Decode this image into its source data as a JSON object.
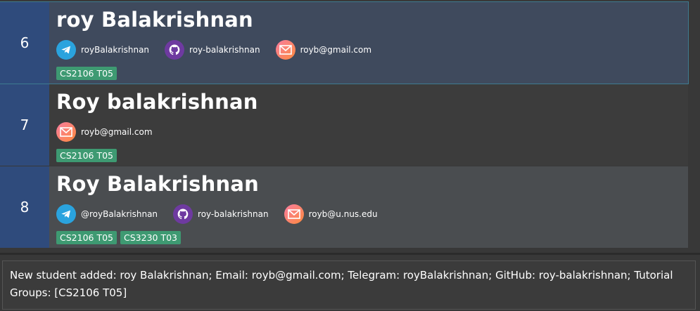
{
  "persons": [
    {
      "index": "6",
      "name": "roy Balakrishnan",
      "telegram": "royBalakrishnan",
      "github": "roy-balakrishnan",
      "email": "royb@gmail.com",
      "tags": [
        "CS2106 T05"
      ]
    },
    {
      "index": "7",
      "name": "Roy balakrishnan",
      "email": "royb@gmail.com",
      "tags": [
        "CS2106 T05"
      ]
    },
    {
      "index": "8",
      "name": "Roy Balakrishnan",
      "telegram": "@royBalakrishnan",
      "github": "roy-balakrishnan",
      "email": "royb@u.nus.edu",
      "tags": [
        "CS2106 T05",
        "CS3230 T03"
      ]
    }
  ],
  "result": {
    "message": "New student added: roy Balakrishnan; Email: royb@gmail.com; Telegram: royBalakrishnan; GitHub: roy-balakrishnan; Tutorial Groups: [CS2106 T05]"
  },
  "colors": {
    "selected_card": "#3f4a5d",
    "index_bg": "#2f4b7c",
    "tag_bg": "#3e9a72",
    "telegram": "#2aa3de",
    "github": "#6e3aa0"
  },
  "icons": {
    "telegram": "telegram-icon",
    "github": "github-icon",
    "email": "email-icon"
  }
}
